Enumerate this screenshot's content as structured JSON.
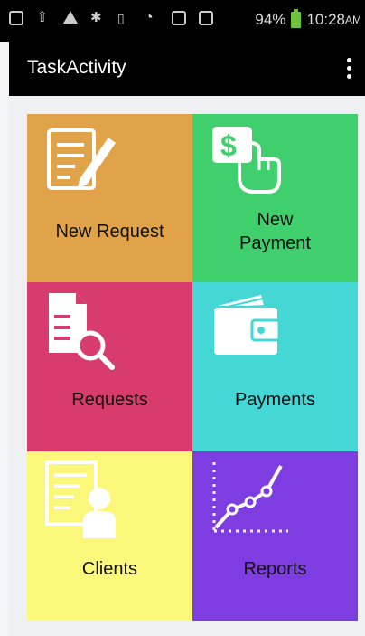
{
  "status": {
    "battery_pct": "94%",
    "time": "10:28",
    "ampm": "AM",
    "icons": [
      "notification-icon",
      "upload-icon",
      "warning-icon",
      "bluetooth-icon",
      "vibrate-icon",
      "wifi-icon",
      "sim-icon",
      "sim2-icon",
      "battery-icon"
    ]
  },
  "appbar": {
    "title": "TaskActivity",
    "menu_icon": "more-vert-icon"
  },
  "tiles": [
    {
      "label": "New Request",
      "icon": "edit-document-icon",
      "color": "#e0a34a"
    },
    {
      "label_line1": "New",
      "label_line2": "Payment",
      "icon": "dollar-touch-icon",
      "color": "#3fcf6c"
    },
    {
      "label": "Requests",
      "icon": "search-document-icon",
      "color": "#d83b6d"
    },
    {
      "label": "Payments",
      "icon": "wallet-icon",
      "color": "#44d7d6"
    },
    {
      "label": "Clients",
      "icon": "client-profile-icon",
      "color": "#fbf77a"
    },
    {
      "label": "Reports",
      "icon": "line-chart-icon",
      "color": "#7d3de0"
    }
  ]
}
